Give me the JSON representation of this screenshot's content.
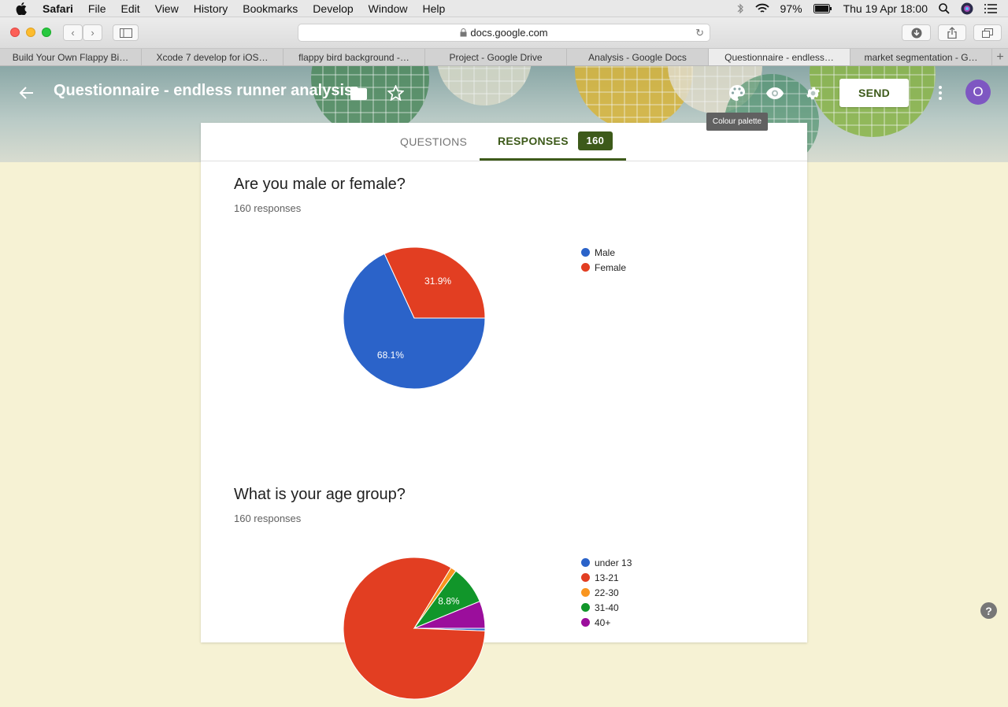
{
  "menubar": {
    "app": "Safari",
    "items": [
      "File",
      "Edit",
      "View",
      "History",
      "Bookmarks",
      "Develop",
      "Window",
      "Help"
    ],
    "battery": "97%",
    "datetime": "Thu 19 Apr  18:00"
  },
  "browser": {
    "url": "docs.google.com",
    "tabs": [
      {
        "label": "Build Your Own Flappy Bi…",
        "active": false
      },
      {
        "label": "Xcode 7 develop for iOS…",
        "active": false
      },
      {
        "label": "flappy bird background -…",
        "active": false
      },
      {
        "label": "Project - Google Drive",
        "active": false
      },
      {
        "label": "Analysis - Google Docs",
        "active": false
      },
      {
        "label": "Questionnaire - endless…",
        "active": true
      },
      {
        "label": "market segmentation - G…",
        "active": false
      }
    ]
  },
  "form": {
    "title": "Questionnaire - endless runner analysis",
    "send_label": "SEND",
    "avatar_letter": "O",
    "tooltip": "Colour palette",
    "tabs": {
      "questions": "QUESTIONS",
      "responses": "RESPONSES",
      "responses_count": "160"
    },
    "theme_color": "#3d5a1a"
  },
  "questions": [
    {
      "title": "Are you male or female?",
      "count_text": "160 responses"
    },
    {
      "title": "What is your age group?",
      "count_text": "160 responses"
    }
  ],
  "chart_data": [
    {
      "type": "pie",
      "title": "Are you male or female?",
      "labels": [
        "Male",
        "Female"
      ],
      "values": [
        68.1,
        31.9
      ],
      "slice_labels": [
        "68.1%",
        "31.9%"
      ],
      "colors": [
        "#2b63c9",
        "#e23e22"
      ],
      "legend": "right"
    },
    {
      "type": "pie",
      "title": "What is your age group?",
      "labels": [
        "under 13",
        "13-21",
        "22-30",
        "31-40",
        "40+"
      ],
      "values": [
        0.6,
        83.1,
        1.3,
        8.8,
        6.2
      ],
      "slice_labels": [
        "",
        "",
        "",
        "8.8%",
        ""
      ],
      "colors": [
        "#2b63c9",
        "#e23e22",
        "#f9951f",
        "#11962a",
        "#9b0e9c"
      ],
      "legend": "right"
    }
  ]
}
